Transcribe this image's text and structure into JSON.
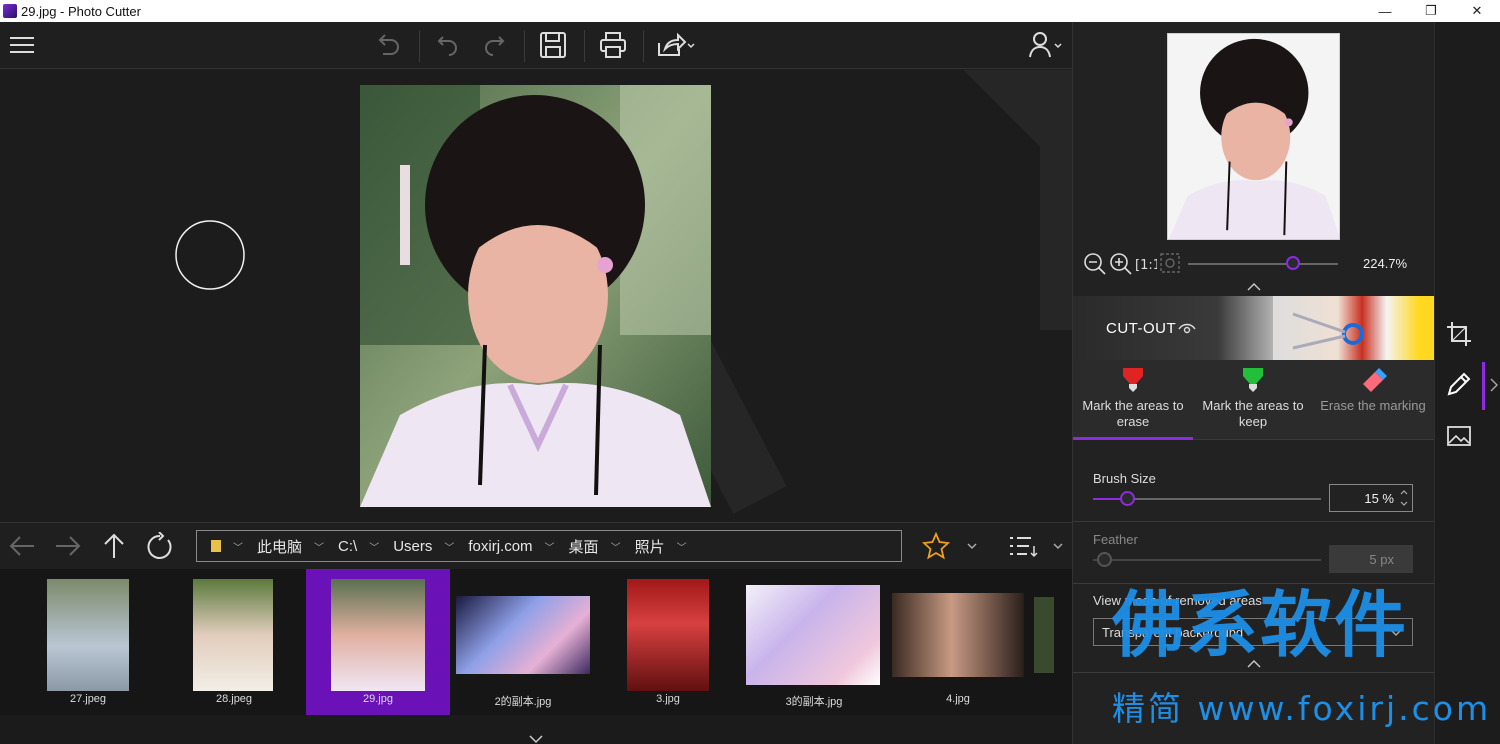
{
  "window": {
    "title": "29.jpg - Photo Cutter",
    "minimize": "—",
    "maximize": "❐",
    "close": "✕"
  },
  "navigation": {
    "path": [
      "此电脑",
      "C:\\",
      "Users",
      "foxirj.com",
      "桌面",
      "照片"
    ]
  },
  "thumbnails": [
    {
      "name": "27.jpeg",
      "selected": false
    },
    {
      "name": "28.jpeg",
      "selected": false
    },
    {
      "name": "29.jpg",
      "selected": true
    },
    {
      "name": "2的副本.jpg",
      "selected": false
    },
    {
      "name": "3.jpg",
      "selected": false
    },
    {
      "name": "3的副本.jpg",
      "selected": false
    },
    {
      "name": "4.jpg",
      "selected": false
    }
  ],
  "right_panel": {
    "zoom": "224.7%",
    "zoom_fraction": 0.7,
    "cutout_title": "CUT-OUT",
    "tools": [
      {
        "label": "Mark the areas to erase",
        "active": true,
        "color": "#e02424"
      },
      {
        "label": "Mark the areas to keep",
        "active": false,
        "color": "#22c03a"
      },
      {
        "label": "Erase the marking",
        "active": false,
        "color": "#ff6a7a"
      }
    ],
    "brush_size_label": "Brush Size",
    "brush_size_value": "15 %",
    "brush_size_fraction": 0.15,
    "feather_label": "Feather",
    "feather_value": "5 px",
    "feather_fraction": 0.05,
    "view_mode_label": "View mode of removed areas",
    "view_mode_value": "Transparent background"
  },
  "watermark": {
    "line1": "佛系软件",
    "line2": "精简 www.foxirj.com"
  },
  "colors": {
    "accent": "#8b2be2",
    "selected_thumb": "#6a12b8",
    "favorite_star": "#f0a020"
  }
}
